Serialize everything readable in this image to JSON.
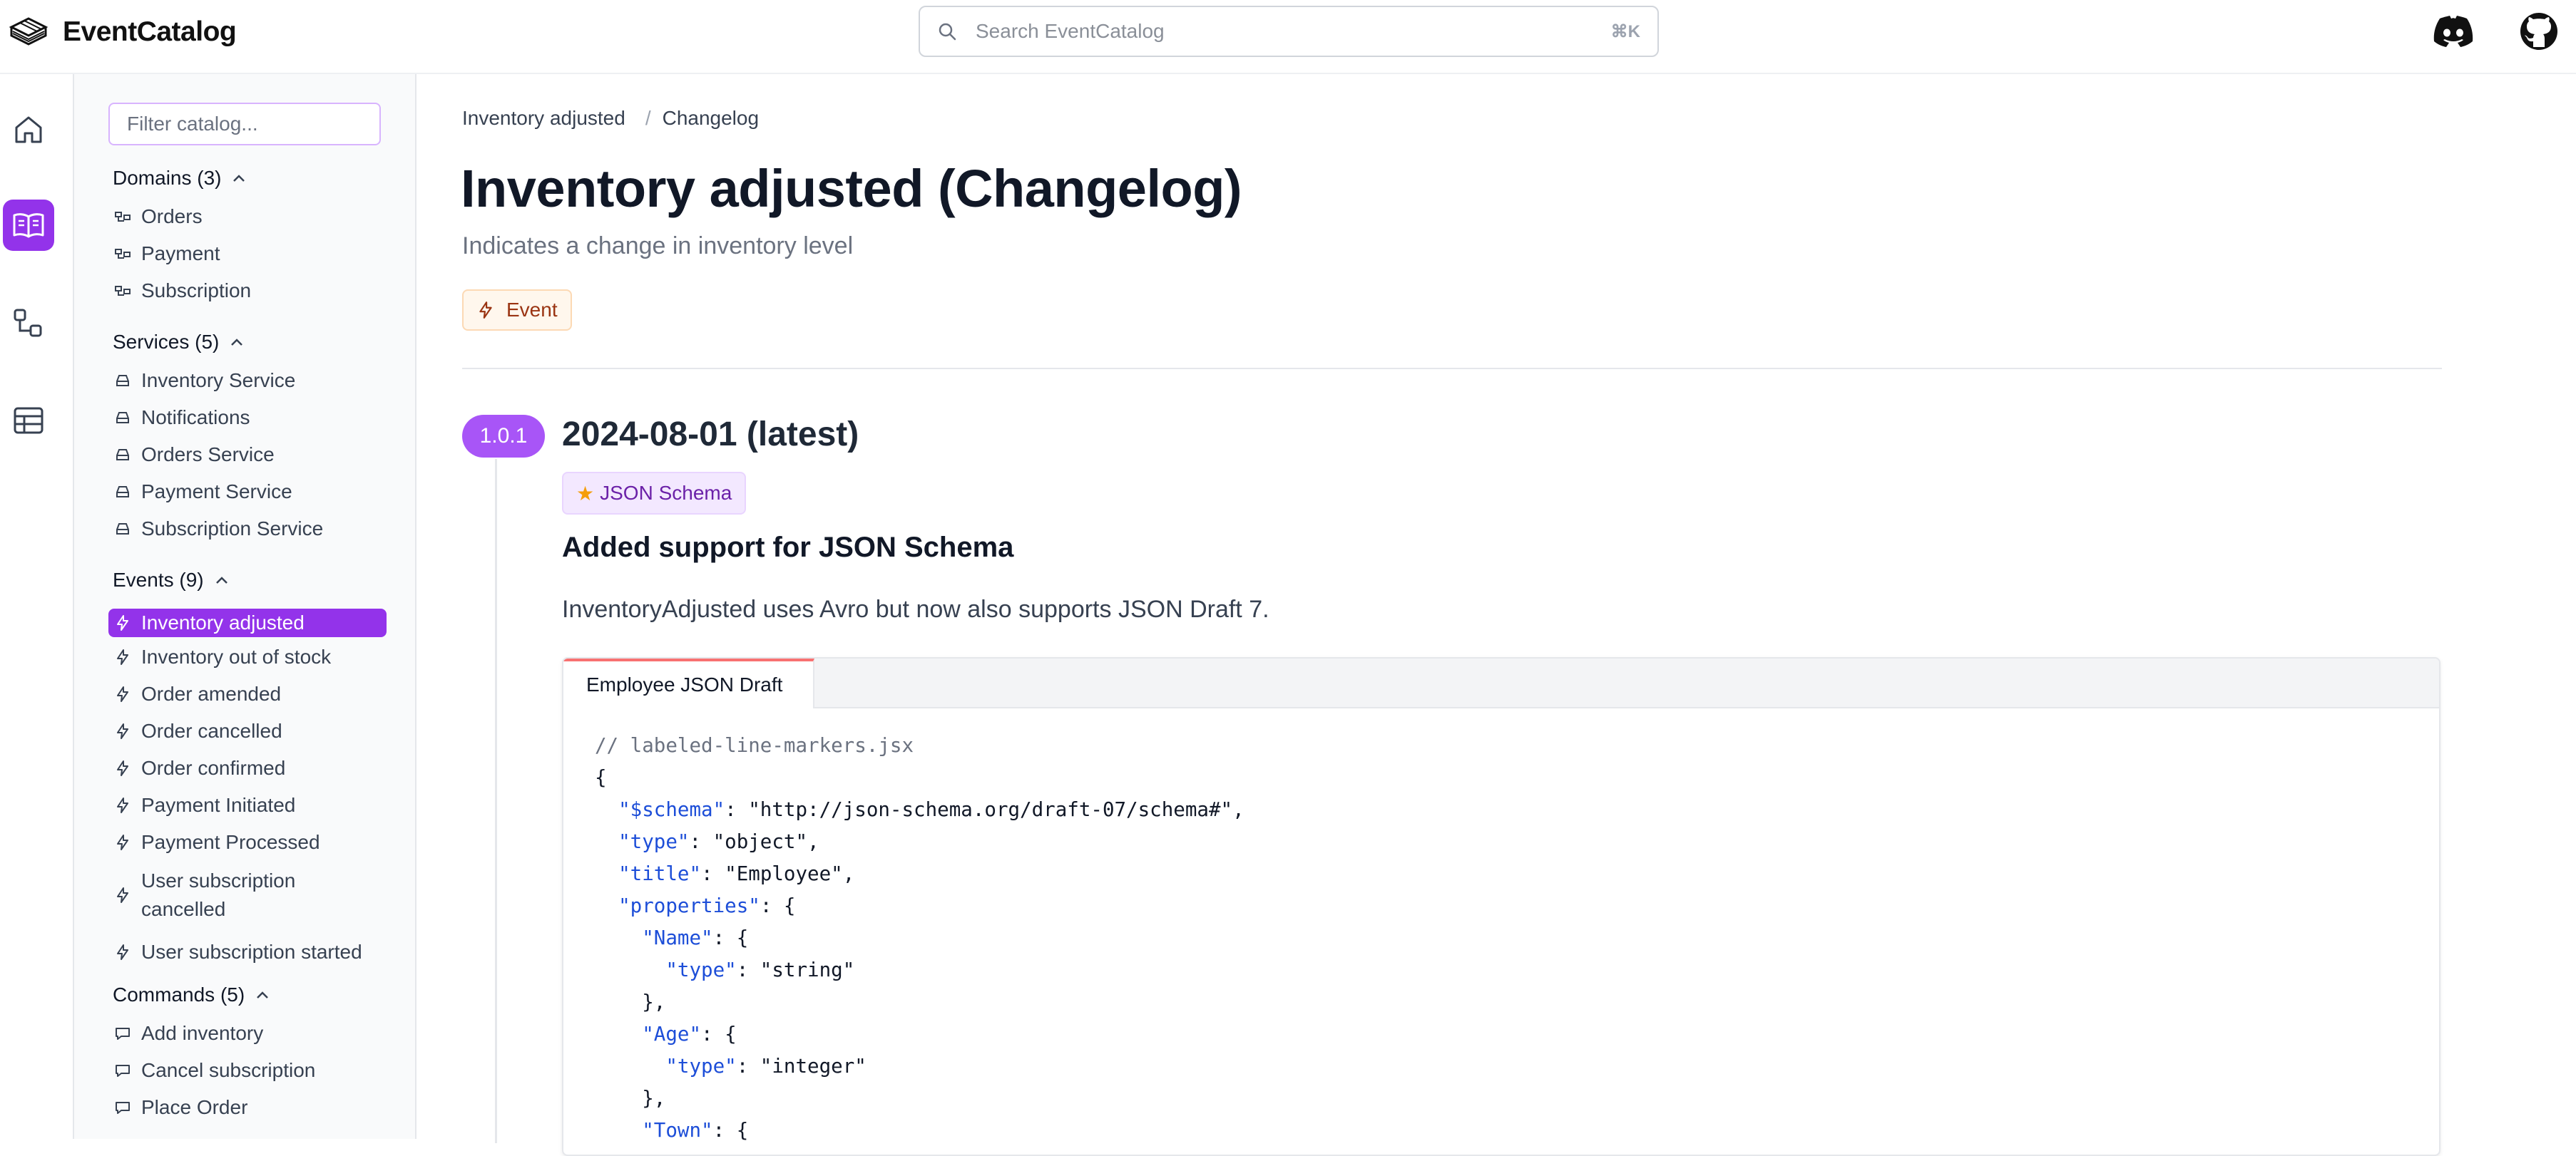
{
  "app": {
    "name": "EventCatalog"
  },
  "search": {
    "placeholder": "Search EventCatalog",
    "shortcut": "⌘K"
  },
  "sidebar": {
    "filter_placeholder": "Filter catalog...",
    "groups": [
      {
        "title": "Domains (3)",
        "items": [
          "Orders",
          "Payment",
          "Subscription"
        ]
      },
      {
        "title": "Services (5)",
        "items": [
          "Inventory Service",
          "Notifications",
          "Orders Service",
          "Payment Service",
          "Subscription Service"
        ]
      },
      {
        "title": "Events (9)",
        "items": [
          "Inventory adjusted",
          "Inventory out of stock",
          "Order amended",
          "Order cancelled",
          "Order confirmed",
          "Payment Initiated",
          "Payment Processed",
          "User subscription cancelled",
          "User subscription started"
        ]
      },
      {
        "title": "Commands (5)",
        "items": [
          "Add inventory",
          "Cancel subscription",
          "Place Order"
        ]
      }
    ],
    "active_item": "Inventory adjusted",
    "multiline": {
      "line1": "User subscription",
      "line2": "cancelled"
    }
  },
  "breadcrumb": [
    "Inventory adjusted",
    "Changelog"
  ],
  "page": {
    "title": "Inventory adjusted (Changelog)",
    "subtitle": "Indicates a change in inventory level",
    "badge": "Event"
  },
  "changelog": [
    {
      "version": "1.0.1",
      "title": "2024-08-01 (latest)",
      "tag": "JSON Schema",
      "heading": "Added support for JSON Schema",
      "body": "InventoryAdjusted uses Avro but now also supports JSON Draft 7.",
      "code_tab": "Employee JSON Draft",
      "code_lines": [
        "// labeled-line-markers.jsx",
        "{",
        "  \"$schema\": \"http://json-schema.org/draft-07/schema#\",",
        "  \"type\": \"object\",",
        "  \"title\": \"Employee\",",
        "  \"properties\": {",
        "    \"Name\": {",
        "      \"type\": \"string\"",
        "    },",
        "    \"Age\": {",
        "      \"type\": \"integer\"",
        "    },",
        "    \"Town\": {"
      ]
    }
  ],
  "colors": {
    "accent": "#9333ea",
    "version_pill": "#a855f7",
    "event_badge_bg": "#fff7ed",
    "tag_bg": "#f3e8ff"
  },
  "icons": {
    "rail": [
      "home-icon",
      "book-open-icon",
      "workflow-icon",
      "table-icon"
    ],
    "top": [
      "discord-icon",
      "github-icon"
    ]
  }
}
